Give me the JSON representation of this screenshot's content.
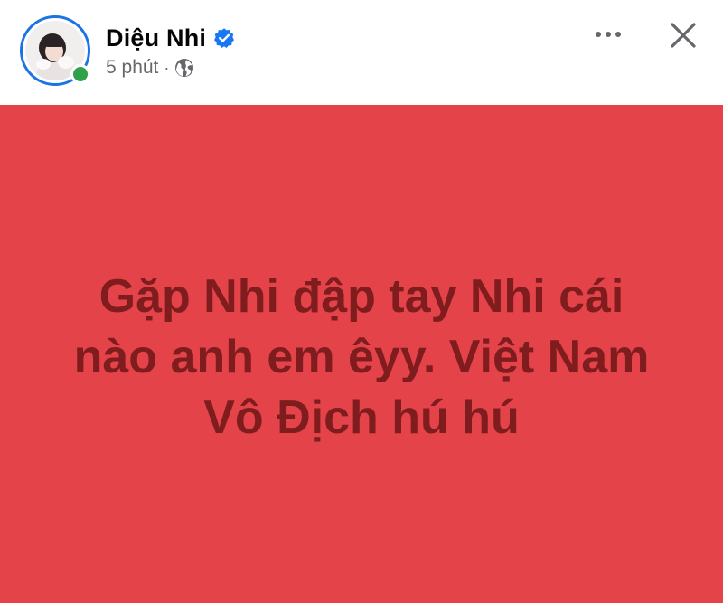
{
  "author": {
    "name": "Diệu Nhi",
    "verified": true,
    "online": true,
    "avatar_icon": "profile-photo"
  },
  "meta": {
    "time": "5 phút",
    "separator": "·",
    "privacy_icon": "globe-icon"
  },
  "actions": {
    "more_icon": "more-icon",
    "close_icon": "close-icon"
  },
  "post": {
    "text": "Gặp Nhi đập tay Nhi cái nào anh em êyy. Việt Nam Vô Địch hú hú"
  },
  "colors": {
    "background": "#e4434a",
    "text": "#7f1c1e",
    "verified": "#1877f2",
    "online": "#31a24c",
    "muted": "#65676b",
    "avatar_ring": "#1b74e4"
  }
}
